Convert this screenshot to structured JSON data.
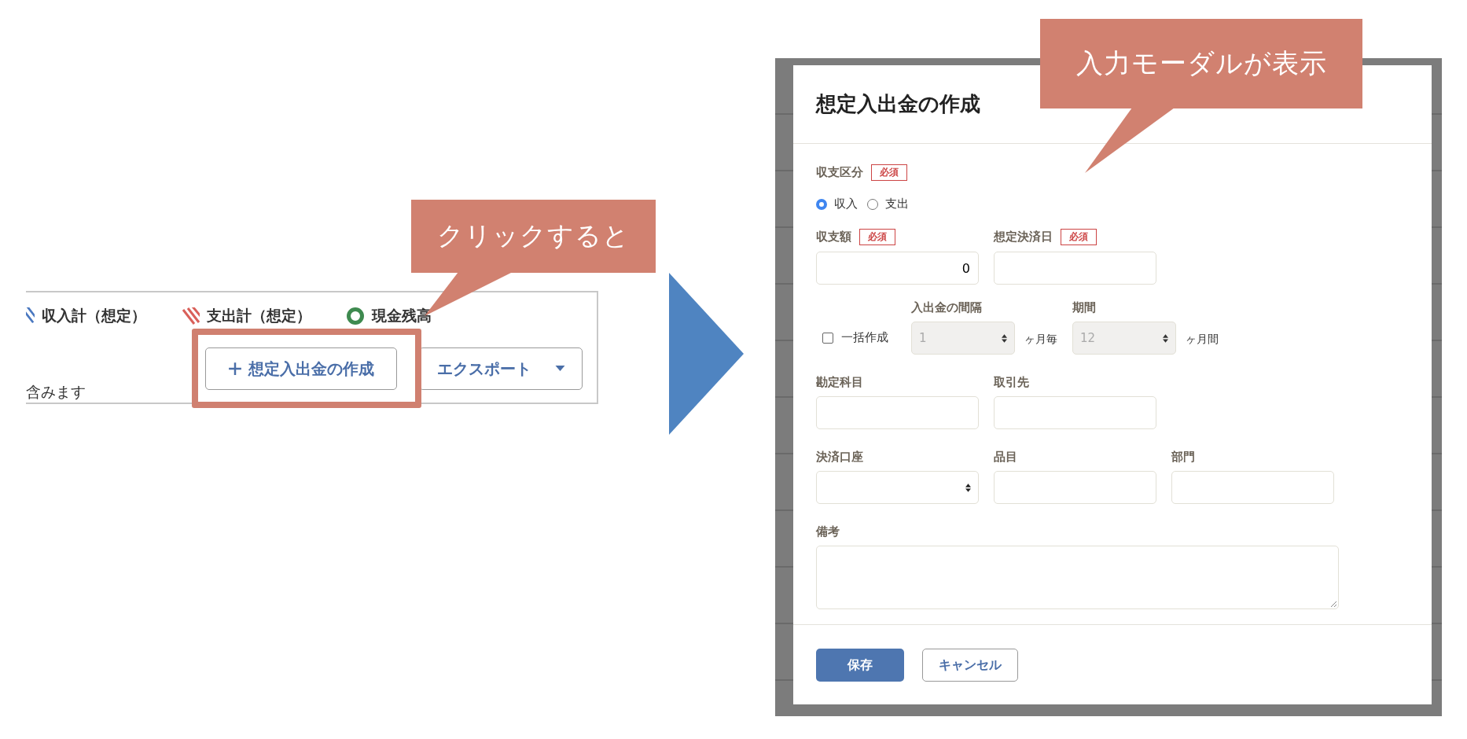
{
  "before": {
    "legend": [
      {
        "label": "収入計（想定）",
        "kind": "income"
      },
      {
        "label": "支出計（想定）",
        "kind": "expense"
      },
      {
        "label": "現金残高",
        "kind": "balance"
      }
    ],
    "create_button": "想定入出金の作成",
    "export_button": "エクスポート",
    "note": "含みます"
  },
  "callouts": [
    {
      "text": "クリックすると"
    },
    {
      "text": "入力モーダルが表示"
    }
  ],
  "modal": {
    "title": "想定入出金の作成",
    "type_field": {
      "label": "収支区分",
      "required": "必須",
      "options": [
        {
          "label": "収入",
          "selected": true
        },
        {
          "label": "支出",
          "selected": false
        }
      ]
    },
    "amount": {
      "label": "収支額",
      "required": "必須",
      "value": "0"
    },
    "date": {
      "label": "想定決済日",
      "required": "必須"
    },
    "bulk": {
      "label": "一括作成",
      "checked": false
    },
    "interval": {
      "label": "入出金の間隔",
      "value": "1",
      "unit": "ヶ月毎",
      "disabled": true
    },
    "period": {
      "label": "期間",
      "value": "12",
      "unit": "ヶ月間",
      "disabled": true
    },
    "row3": [
      {
        "label": "勘定科目",
        "kind": "text"
      },
      {
        "label": "取引先",
        "kind": "text"
      }
    ],
    "row4": [
      {
        "label": "決済口座",
        "kind": "select"
      },
      {
        "label": "品目",
        "kind": "text"
      },
      {
        "label": "部門",
        "kind": "text"
      }
    ],
    "memo": {
      "label": "備考"
    },
    "buttons": [
      {
        "label": "保存",
        "kind": "primary"
      },
      {
        "label": "キャンセル",
        "kind": "secondary"
      }
    ]
  }
}
